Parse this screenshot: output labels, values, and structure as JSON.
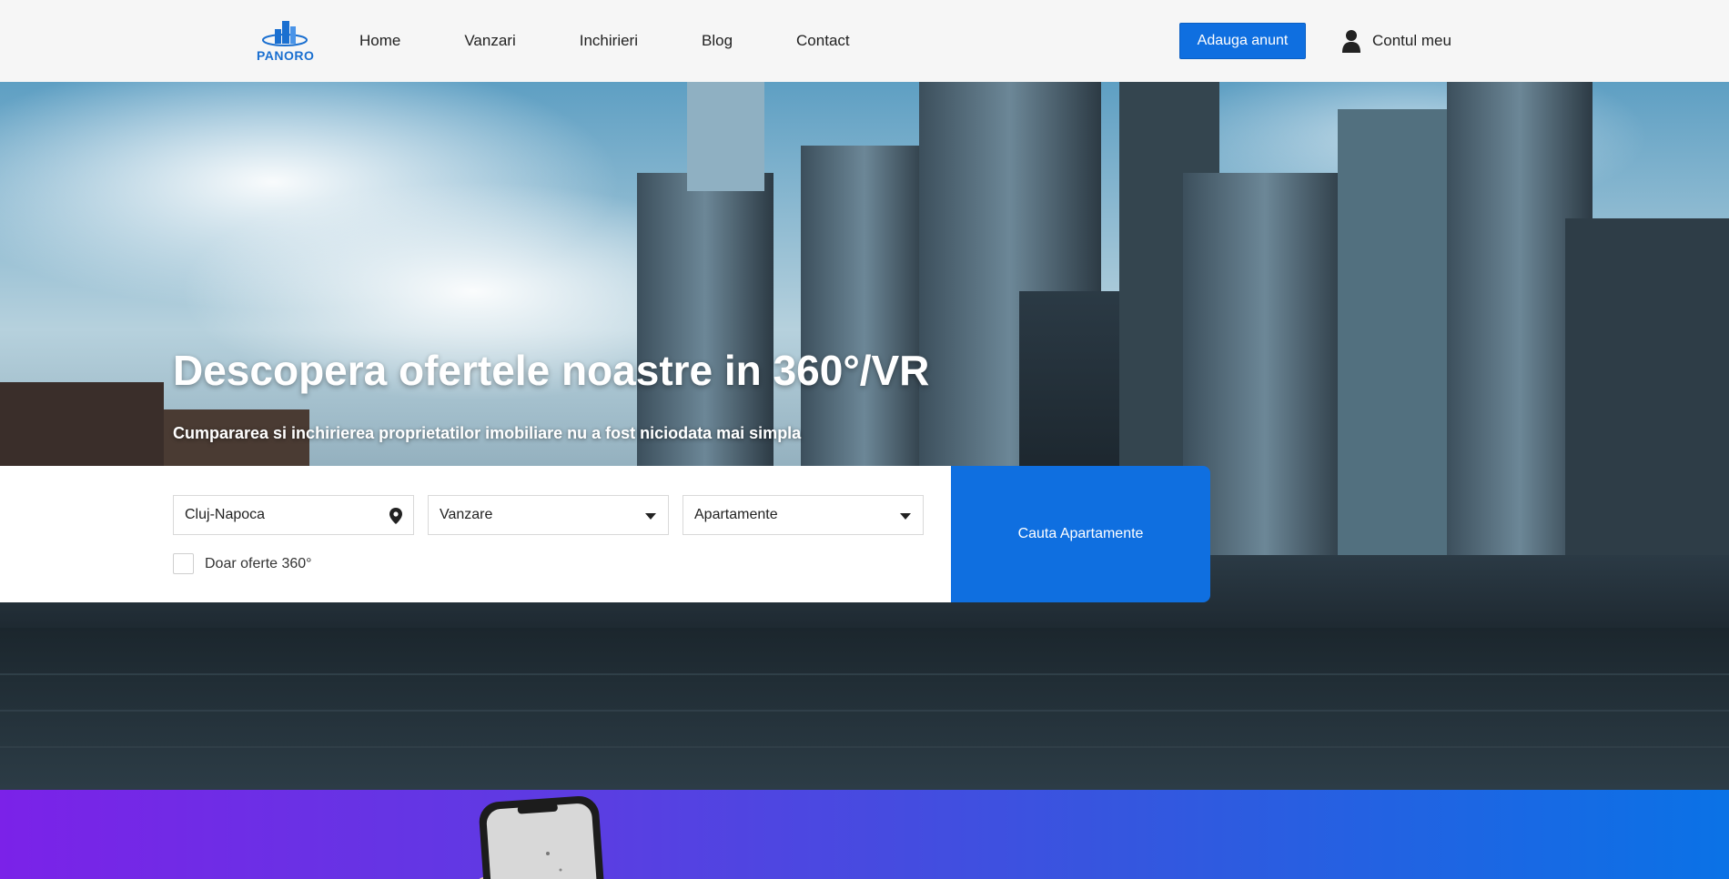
{
  "header": {
    "logo_text": "PANORO",
    "nav": [
      "Home",
      "Vanzari",
      "Inchirieri",
      "Blog",
      "Contact"
    ],
    "add_button": "Adauga anunt",
    "account_label": "Contul meu",
    "account_icon": "user-icon"
  },
  "hero": {
    "title": "Descopera ofertele noastre in 360°/VR",
    "subtitle": "Cumpararea si inchirierea proprietatilor imobiliare nu a fost niciodata mai simpla"
  },
  "search": {
    "location_value": "Cluj-Napoca",
    "location_icon": "map-pin-icon",
    "transaction_value": "Vanzare",
    "property_value": "Apartamente",
    "only_360_label": "Doar oferte 360°",
    "only_360_checked": false,
    "search_button": "Cauta Apartamente"
  },
  "colors": {
    "accent": "#0f6fe0",
    "header_bg": "#f6f6f6",
    "band_start": "#7b22e8",
    "band_end": "#0a72e6"
  }
}
